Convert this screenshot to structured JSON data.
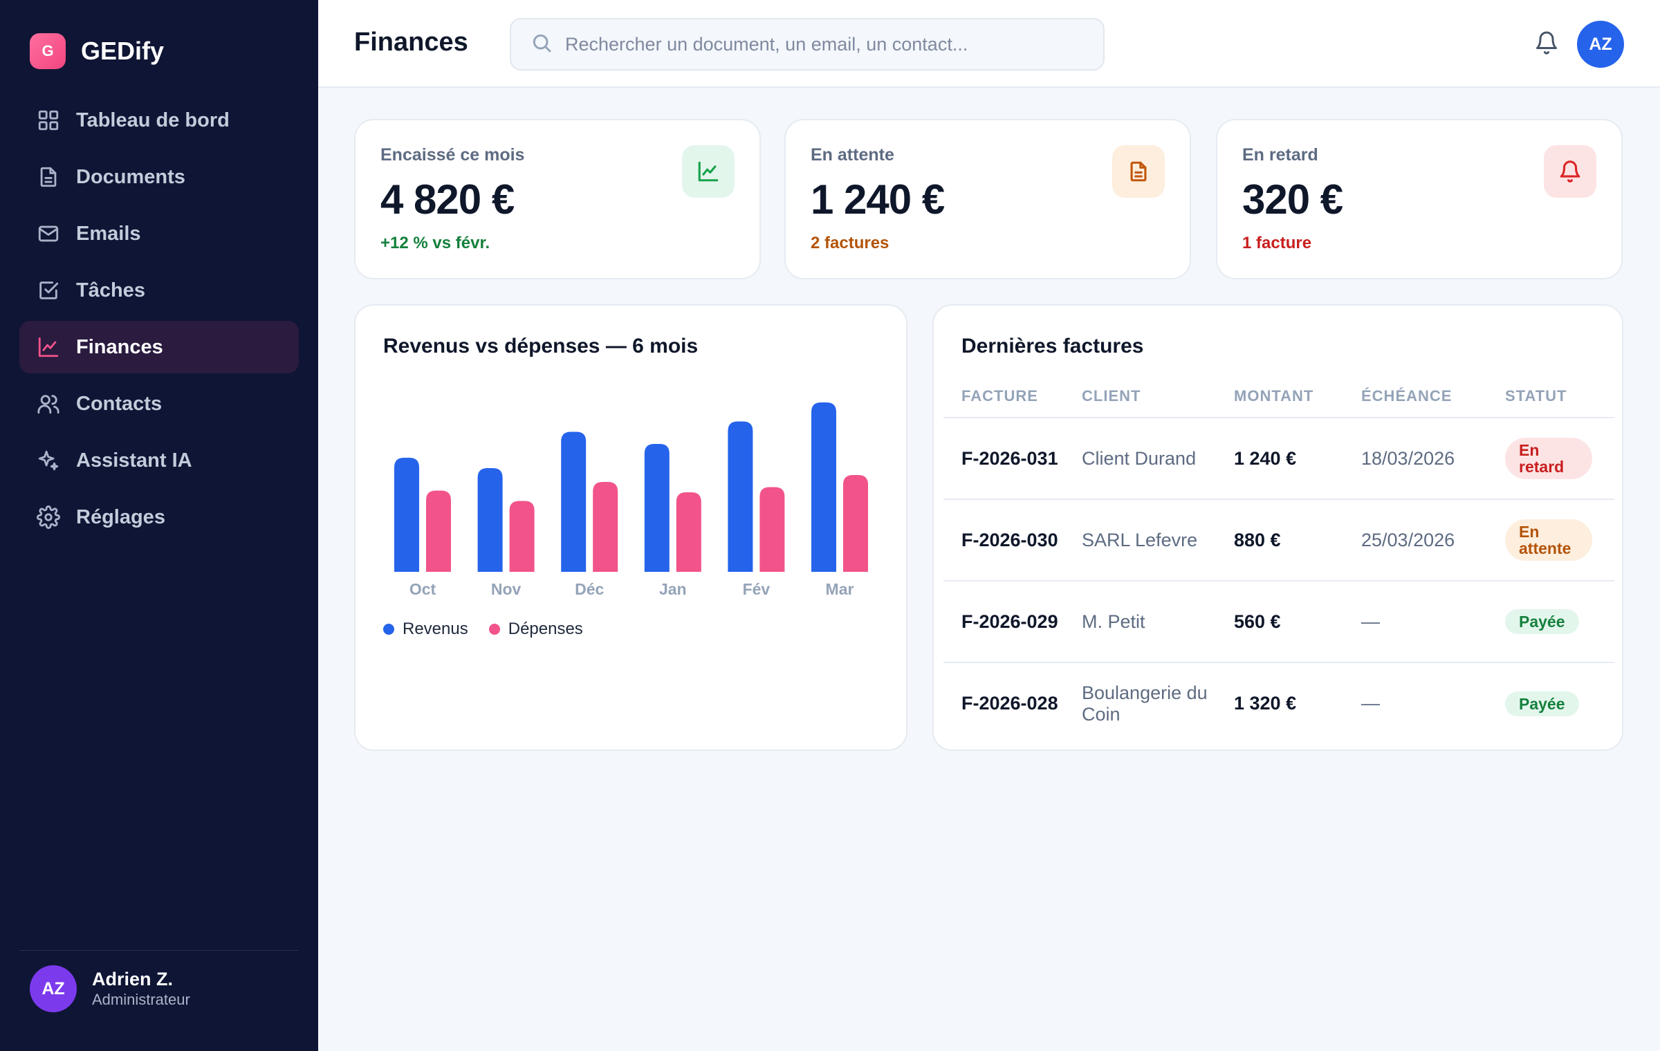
{
  "brand": {
    "logo_letter": "G",
    "name": "GEDify"
  },
  "sidebar": {
    "items": [
      {
        "label": "Tableau de bord",
        "icon": "grid-icon",
        "active": false
      },
      {
        "label": "Documents",
        "icon": "document-icon",
        "active": false
      },
      {
        "label": "Emails",
        "icon": "mail-icon",
        "active": false
      },
      {
        "label": "Tâches",
        "icon": "checkbox-icon",
        "active": false
      },
      {
        "label": "Finances",
        "icon": "chart-line-icon",
        "active": true
      },
      {
        "label": "Contacts",
        "icon": "users-icon",
        "active": false
      },
      {
        "label": "Assistant IA",
        "icon": "sparkle-icon",
        "active": false
      },
      {
        "label": "Réglages",
        "icon": "gear-icon",
        "active": false
      }
    ],
    "user": {
      "initials": "AZ",
      "name": "Adrien Z.",
      "role": "Administrateur"
    }
  },
  "header": {
    "title": "Finances",
    "search_placeholder": "Rechercher un document, un email, un contact...",
    "avatar_initials": "AZ"
  },
  "stats": [
    {
      "label": "Encaissé ce mois",
      "value": "4 820 €",
      "note": "+12 % vs févr.",
      "note_color": "#15803d",
      "icon": "chart-line-icon",
      "icon_bg": "#e3f6ec",
      "icon_color": "#16a34a"
    },
    {
      "label": "En attente",
      "value": "1 240 €",
      "note": "2 factures",
      "note_color": "#b45309",
      "icon": "document-icon",
      "icon_bg": "#fdeedd",
      "icon_color": "#c2570c"
    },
    {
      "label": "En retard",
      "value": "320 €",
      "note": "1 facture",
      "note_color": "#c81e1e",
      "icon": "bell-icon",
      "icon_bg": "#fde4e4",
      "icon_color": "#dc2626"
    }
  ],
  "chart_data": {
    "type": "bar",
    "title": "Revenus vs dépenses — 6 mois",
    "categories": [
      "Oct",
      "Nov",
      "Déc",
      "Jan",
      "Fév",
      "Mar"
    ],
    "series": [
      {
        "name": "Revenus",
        "color": "#2563eb",
        "values": [
          0.66,
          0.6,
          0.81,
          0.74,
          0.87,
          0.98
        ]
      },
      {
        "name": "Dépenses",
        "color": "#f2538a",
        "values": [
          0.47,
          0.41,
          0.52,
          0.46,
          0.49,
          0.56
        ]
      }
    ],
    "ylim": [
      0,
      1
    ],
    "grid": false,
    "legend": "bottom-left"
  },
  "invoices": {
    "title": "Dernières factures",
    "columns": [
      "FACTURE",
      "CLIENT",
      "MONTANT",
      "ÉCHÉANCE",
      "STATUT"
    ],
    "rows": [
      {
        "id": "F-2026-031",
        "client": "Client Durand",
        "amount": "1 240 €",
        "due": "18/03/2026",
        "status": "En retard",
        "status_kind": "late"
      },
      {
        "id": "F-2026-030",
        "client": "SARL Lefevre",
        "amount": "880 €",
        "due": "25/03/2026",
        "status": "En attente",
        "status_kind": "wait"
      },
      {
        "id": "F-2026-029",
        "client": "M. Petit",
        "amount": "560 €",
        "due": "—",
        "status": "Payée",
        "status_kind": "paid"
      },
      {
        "id": "F-2026-028",
        "client": "Boulangerie du Coin",
        "amount": "1 320 €",
        "due": "—",
        "status": "Payée",
        "status_kind": "paid"
      }
    ]
  }
}
